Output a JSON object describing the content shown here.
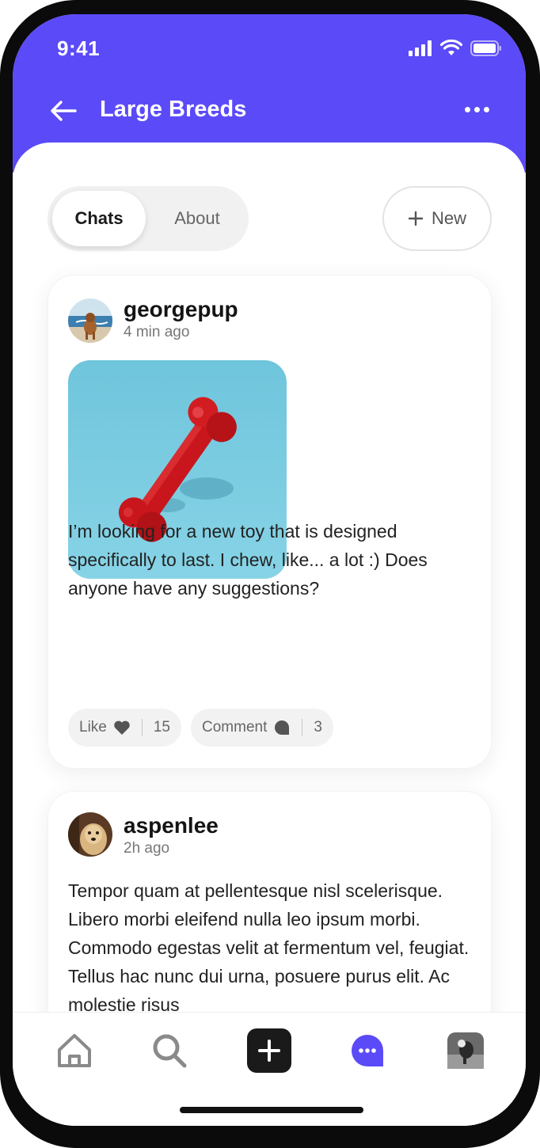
{
  "status": {
    "time": "9:41"
  },
  "header": {
    "title": "Large Breeds"
  },
  "tabs": {
    "chats": "Chats",
    "about": "About"
  },
  "new_button": "New",
  "posts": [
    {
      "username": "georgepup",
      "time": "4 min ago",
      "text": "I’m looking for  a  new toy that  is designed specifically to last. I chew, like... a lot :) Does anyone have any suggestions?",
      "like_label": "Like",
      "like_count": "15",
      "comment_label": "Comment",
      "comment_count": "3"
    },
    {
      "username": "aspenlee",
      "time": "2h ago",
      "text": "Tempor quam at pellentesque nisl scelerisque. Libero morbi eleifend nulla leo ipsum morbi. Commodo egestas velit at fermentum vel, feugiat. Tellus hac nunc dui urna, posuere purus elit. Ac molestie risus"
    }
  ],
  "tabbar": [
    "home-icon",
    "search-icon",
    "add-icon",
    "chat-icon",
    "profile-avatar"
  ],
  "colors": {
    "accent": "#5b4af8",
    "like_icon": "#555555"
  }
}
